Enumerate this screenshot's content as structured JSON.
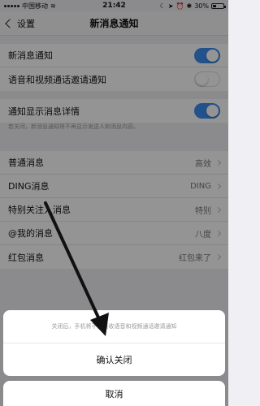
{
  "status_bar": {
    "carrier": "中国移动",
    "time": "21:42",
    "battery": "30%"
  },
  "nav": {
    "back_label": "设置",
    "title": "新消息通知"
  },
  "switches": [
    {
      "label": "新消息通知",
      "state": "on"
    },
    {
      "label": "语音和视频通话邀请通知",
      "state": "off"
    }
  ],
  "detail_switch": {
    "label": "通知显示消息详情",
    "state": "on"
  },
  "detail_hint": "若关闭，新消息通知将不再显示发送人和消息内容。",
  "sound_settings": [
    {
      "label": "普通消息",
      "value": "高效"
    },
    {
      "label": "DING消息",
      "value": "DING"
    },
    {
      "label": "特别关注人消息",
      "value": "特别"
    },
    {
      "label": "@我的消息",
      "value": "八度"
    },
    {
      "label": "红包消息",
      "value": "红包来了"
    }
  ],
  "action_sheet": {
    "message": "关闭后，手机将不再接收语音和视频通话邀请通知",
    "confirm_label": "确认关闭",
    "cancel_label": "取消"
  },
  "colors": {
    "toggle_on": "#3c8cf0",
    "overlay": "rgba(0,0,0,0.42)"
  }
}
